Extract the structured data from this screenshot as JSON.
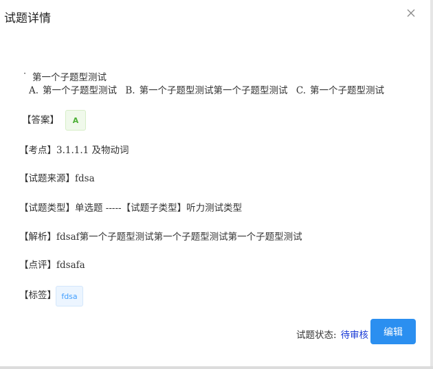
{
  "dialog": {
    "title": "试题详情",
    "close_icon": "close-icon"
  },
  "question": {
    "bullet": "·",
    "title": "第一个子题型测试",
    "options": [
      {
        "key": "A.",
        "text": "第一个子题型测试"
      },
      {
        "key": "B.",
        "text": "第一个子题型测试第一个子题型测试"
      },
      {
        "key": "C.",
        "text": "第一个子题型测试"
      }
    ]
  },
  "answer": {
    "label": "【答案】",
    "value": "A"
  },
  "knowledge_point": {
    "label": "【考点】",
    "value": "3.1.1.1 及物动词"
  },
  "source": {
    "label": "【试题来源】",
    "value": "fdsa"
  },
  "type": {
    "label": "【试题类型】",
    "value": "单选题 -----",
    "sub_label": "【试题子类型】",
    "sub_value": "听力测试类型"
  },
  "analysis": {
    "label": "【解析】",
    "value": "fdsaf第一个子题型测试第一个子题型测试第一个子题型测试"
  },
  "comment": {
    "label": "【点评】",
    "value": "fdsafa"
  },
  "tags": {
    "label": "【标签】",
    "items": [
      "fdsa"
    ]
  },
  "footer": {
    "status_label": "试题状态:",
    "status_value": "待审核",
    "edit_label": "编辑"
  },
  "colors": {
    "primary": "#2b8ff0",
    "status": "#1a3bd6",
    "success": "#4caf35",
    "info_tag": "#409eff"
  }
}
